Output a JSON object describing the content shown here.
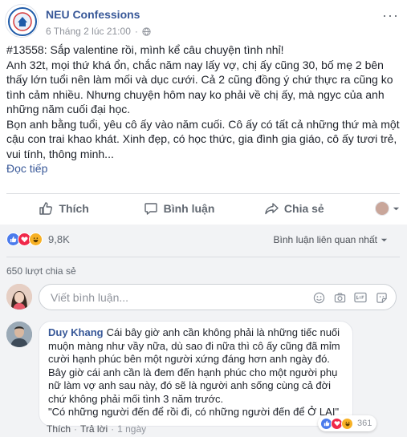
{
  "post": {
    "page_name": "NEU Confessions",
    "timestamp": "6 Tháng 2 lúc 21:00",
    "meta_separator": "·",
    "more_label": "···",
    "paragraphs": [
      "#13558: Sắp valentine rồi, mình kể câu chuyện tình nhỉ!",
      "Anh 32t, mọi thứ khá ổn, chắc năm nay lấy vợ, chị ấy cũng 30, bố mẹ 2 bên thấy lớn tuổi nên làm mối và dục cưới. Cả 2 cũng đồng ý chứ thực ra cũng ko tình cảm nhiều. Nhưng chuyện hôm nay ko phải về chị ấy, mà ngyc của anh những năm cuối đại học.",
      "Bọn anh bằng tuổi, yêu cô ấy vào năm cuối. Cô ấy có tất cả những thứ mà một cậu con trai khao khát. Xinh đẹp, có học thức, gia đình gia giáo, cô ấy tươi trẻ, vui tính, thông minh..."
    ],
    "read_more": "Đọc tiếp"
  },
  "actions": {
    "like": "Thích",
    "comment": "Bình luận",
    "share": "Chia sẻ"
  },
  "stats": {
    "reaction_count": "9,8K",
    "comment_sort": "Bình luận liên quan nhất",
    "shares": "650 lượt chia sẻ"
  },
  "composer": {
    "placeholder": "Viết bình luận..."
  },
  "comment": {
    "author": "Duy Khang",
    "text": "Cái bây giờ anh cần không phải là những tiếc nuối muộn màng như vầy nữa, dù sao đi nữa thì cô ấy cũng đã mỉm cười hạnh phúc bên một người xứng đáng hơn anh ngày đó. Bây giờ cái anh cần là đem đến hạnh phúc cho một người phụ nữ làm vợ anh sau này, đó sẽ là người anh sống cùng cả đời chứ không phải mối tình 3 năm trước.",
    "quote": "\"Có những người đến để rồi đi, có những người đến để Ở LẠI\"",
    "reaction_count": "361",
    "like_label": "Thích",
    "reply_label": "Trả lời",
    "separator": "·",
    "age": "1 ngày"
  },
  "colors": {
    "link": "#385898",
    "like_blue": "#4b7bec",
    "love_red": "#f0284a",
    "haha_yellow": "#f7b125",
    "muted": "#90949c",
    "grey_bg": "#f2f3f5"
  },
  "icons": [
    "globe-icon",
    "like-icon",
    "comment-icon",
    "share-icon",
    "chevron-down-icon",
    "emoji-icon",
    "camera-icon",
    "gif-icon",
    "sticker-icon"
  ]
}
